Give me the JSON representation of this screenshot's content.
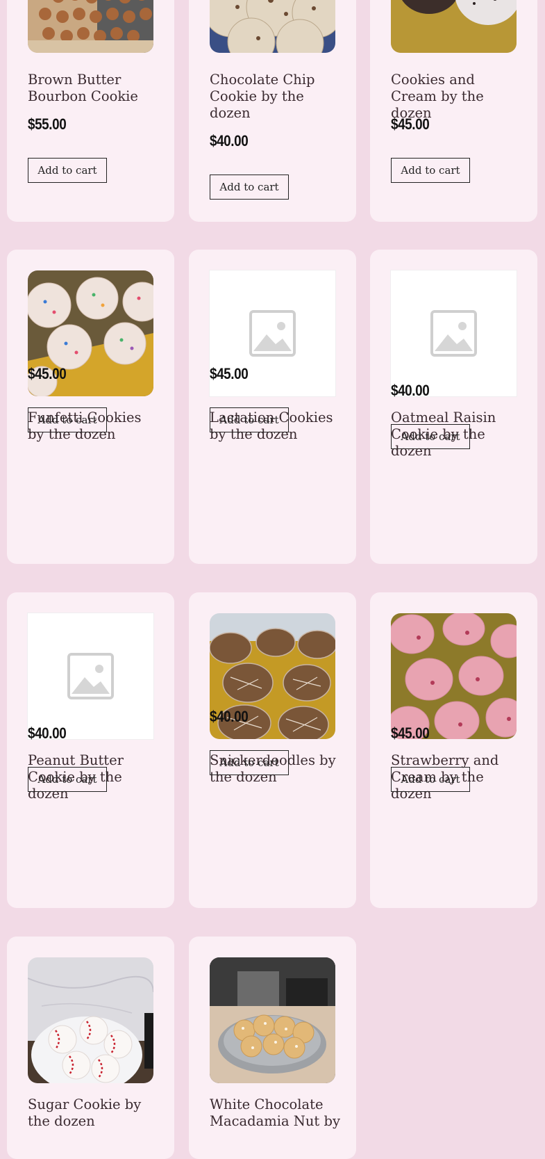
{
  "products": [
    {
      "title": "Brown Butter Bourbon Cookie",
      "price": "$55.00",
      "button": "Add to cart",
      "image": "photo-cookies-tray"
    },
    {
      "title": "Chocolate Chip Cookie by the dozen",
      "price": "$40.00",
      "button": "Add to cart",
      "image": "photo-chocolate-chip"
    },
    {
      "title": "Cookies and Cream by the dozen",
      "price": "$45.00",
      "button": "Add to cart",
      "image": "photo-cookies-cream"
    },
    {
      "title": "Funfetti Cookies by the dozen",
      "price": "$45.00",
      "button": "Add to cart",
      "image": "photo-funfetti"
    },
    {
      "title": "Lactation Cookies by the dozen",
      "price": "$45.00",
      "button": "Add to cart",
      "image": "placeholder-image-icon"
    },
    {
      "title": "Oatmeal Raisin Cookie by the dozen",
      "price": "$40.00",
      "button": "Add to cart",
      "image": "placeholder-image-icon"
    },
    {
      "title": "Peanut Butter Cookie by the dozen",
      "price": "$40.00",
      "button": "Add to cart",
      "image": "placeholder-image-icon"
    },
    {
      "title": "Snickerdoodles by the dozen",
      "price": "$40.00",
      "button": "Add to cart",
      "image": "photo-snickerdoodles"
    },
    {
      "title": "Strawberry and Cream by the dozen",
      "price": "$45.00",
      "button": "Add to cart",
      "image": "photo-strawberry"
    },
    {
      "title": "Sugar Cookie by the dozen",
      "image": "photo-baseball-sugar-cookies"
    },
    {
      "title": "White Chocolate Macadamia Nut by",
      "image": "photo-white-choc-macadamia"
    }
  ],
  "colors": {
    "page_background": "#f2dae6",
    "card_background": "#fbeff5",
    "text": "#3a2a30",
    "price": "#111111",
    "button_border": "#222222"
  }
}
